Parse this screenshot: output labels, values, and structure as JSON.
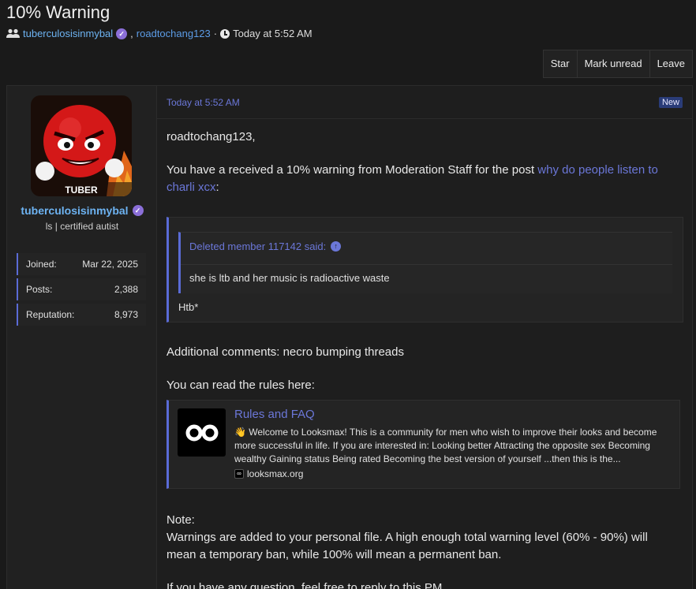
{
  "thread": {
    "title": "10% Warning",
    "participant_1": "tuberculosisinmybal",
    "separator": ",",
    "participant_2": "roadtochang123",
    "dot": "·",
    "time": "Today at 5:52 AM"
  },
  "actions": {
    "star": "Star",
    "mark_unread": "Mark unread",
    "leave": "Leave"
  },
  "author": {
    "name": "tuberculosisinmybal",
    "title": "ls | certified autist",
    "avatar_caption": "TUBER",
    "stats": [
      {
        "label": "Joined:",
        "value": "Mar 22, 2025"
      },
      {
        "label": "Posts:",
        "value": "2,388"
      },
      {
        "label": "Reputation:",
        "value": "8,973"
      }
    ]
  },
  "message": {
    "date": "Today at 5:52 AM",
    "badge": "New",
    "greeting": "roadtochang123,",
    "warning_text": "You have a received a 10% warning from Moderation Staff for the post",
    "post_link": "why do people listen to charli xcx",
    "colon": ":",
    "quote": {
      "author_line": "Deleted member 117142 said:",
      "text": "she is ltb and her music is radioactive waste",
      "extra": "Htb*"
    },
    "additional": "Additional comments: necro bumping threads",
    "rules_intro": "You can read the rules here:",
    "embed": {
      "title": "Rules and FAQ",
      "description": "👋 Welcome to Looksmax! This is a community for men who wish to improve their looks and become more successful in life. If you are interested in: Looking better Attracting the opposite sex Becoming wealthy Gaining status Being rated Becoming the best version of yourself ...then this is the...",
      "domain": "looksmax.org"
    },
    "note_label": "Note:",
    "note_text": "Warnings are added to your personal file. A high enough total warning level (60% - 90%) will mean a temporary ban, while 100% will mean a permanent ban.",
    "closing": "If you have any question, feel free to reply to this PM"
  },
  "colors": {
    "background": "#1a1a1a",
    "link": "#5c9ce6",
    "accent": "#6b77d8",
    "verified": "#8b6fd8"
  }
}
